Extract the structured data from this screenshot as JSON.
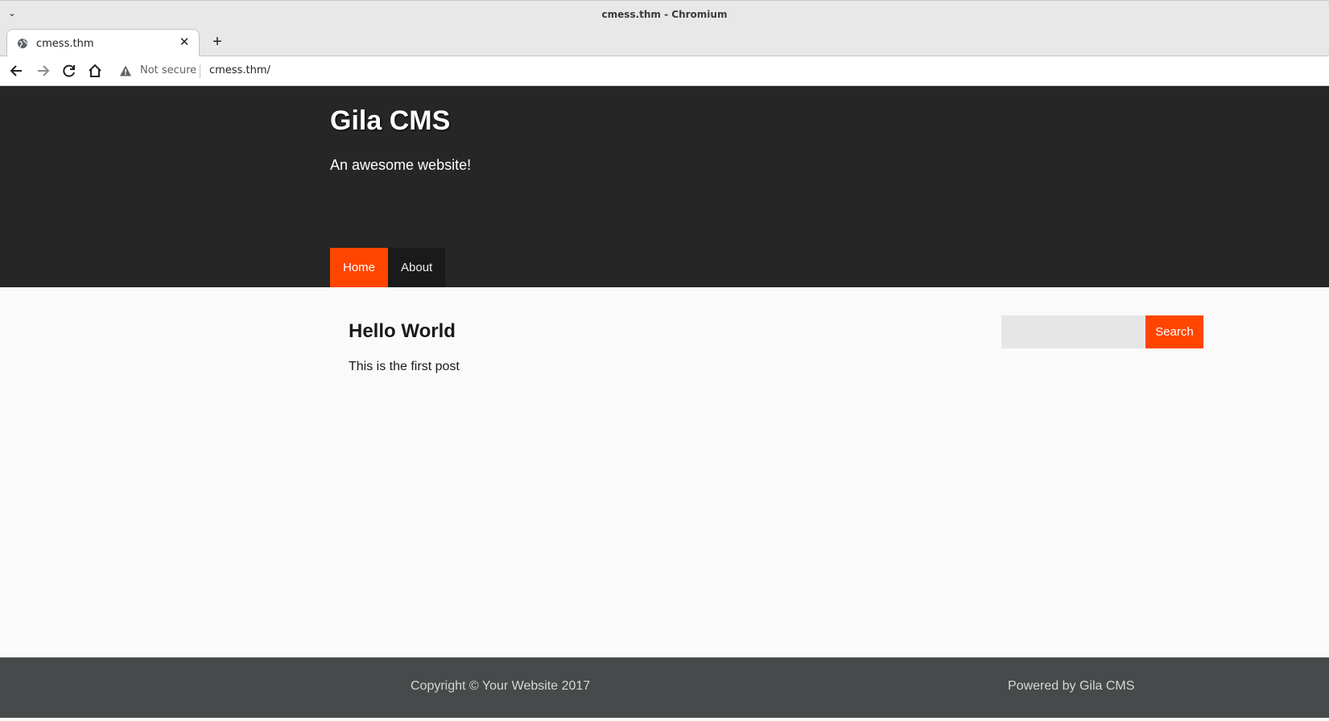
{
  "browser": {
    "window_title": "cmess.thm - Chromium",
    "tab": {
      "title": "cmess.thm",
      "close_glyph": "✕"
    },
    "new_tab_glyph": "+",
    "tabs_menu_glyph": "⌄",
    "security_label": "Not secure",
    "url": "cmess.thm/",
    "icons": [
      "back-arrow-icon",
      "forward-arrow-icon",
      "reload-icon",
      "home-icon",
      "warning-icon",
      "globe-icon"
    ]
  },
  "site": {
    "title": "Gila CMS",
    "description": "An awesome website!",
    "nav": [
      {
        "label": "Home",
        "active": true
      },
      {
        "label": "About",
        "active": false
      }
    ],
    "accent_color": "#ff4500",
    "header_color": "#262626"
  },
  "post": {
    "title": "Hello World",
    "body": "This is the first post"
  },
  "search": {
    "value": "",
    "placeholder": "",
    "button_label": "Search"
  },
  "footer": {
    "copyright": "Copyright © Your Website 2017",
    "powered_by": "Powered by Gila CMS"
  }
}
